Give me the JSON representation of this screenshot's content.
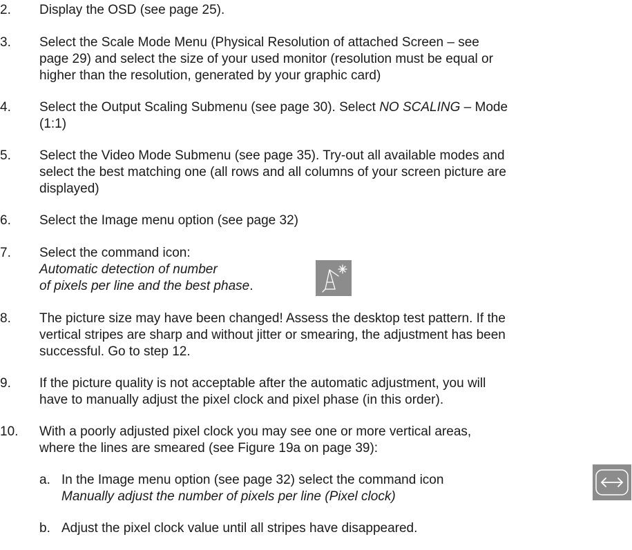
{
  "steps": [
    {
      "num": "2.",
      "text": "Display the OSD (see page 25)."
    },
    {
      "num": "3.",
      "lines": [
        "Select the Scale Mode Menu (Physical Resolution of attached Screen – see",
        "page 29) and select the size of your used monitor (resolution must be equal or",
        "higher than the resolution, generated by your graphic card)"
      ]
    },
    {
      "num": "4.",
      "line1_pre": "Select the Output Scaling Submenu (see page 30). Select ",
      "line1_italic": "NO SCALING",
      "line1_post": " – Mode",
      "line2": "(1:1)"
    },
    {
      "num": "5.",
      "lines": [
        "Select the Video Mode Submenu (see page 35). Try-out all available modes and",
        "select the best matching one (all rows and all columns of your screen picture are",
        "displayed)"
      ]
    },
    {
      "num": "6.",
      "text": "Select the Image menu option (see page 32)"
    },
    {
      "num": "7.",
      "line1": "Select the command icon:",
      "italic_lines": [
        "Automatic detection of number",
        "of pixels per line and the best phase"
      ],
      "tail": ".",
      "icon": "auto-detect-icon"
    },
    {
      "num": "8.",
      "lines": [
        "The picture size may have been changed! Assess the desktop test pattern. If the",
        "vertical stripes are sharp and without jitter or smearing, the adjustment has been",
        "successful. Go to step 12."
      ]
    },
    {
      "num": "9.",
      "lines": [
        "If the picture quality is not acceptable after the automatic adjustment, you will",
        "have to manually adjust the pixel clock and pixel phase (in this order)."
      ]
    },
    {
      "num": "10.",
      "lines": [
        "With a poorly adjusted pixel clock you may see one or more vertical areas,",
        "where the lines are smeared (see Figure 19a on page 39):"
      ]
    }
  ],
  "substeps": [
    {
      "letter": "a.",
      "line1": "In the Image menu option (see page 32) select the command icon",
      "line2_italic": "Manually adjust the number of pixels per line (Pixel clock)",
      "icon": "pixel-clock-arrows-icon"
    },
    {
      "letter": "b.",
      "text": "Adjust the pixel clock value until all stripes have disappeared."
    }
  ],
  "colors": {
    "text": "#1a1a1a",
    "icon_bg": "#8c8c8c"
  }
}
